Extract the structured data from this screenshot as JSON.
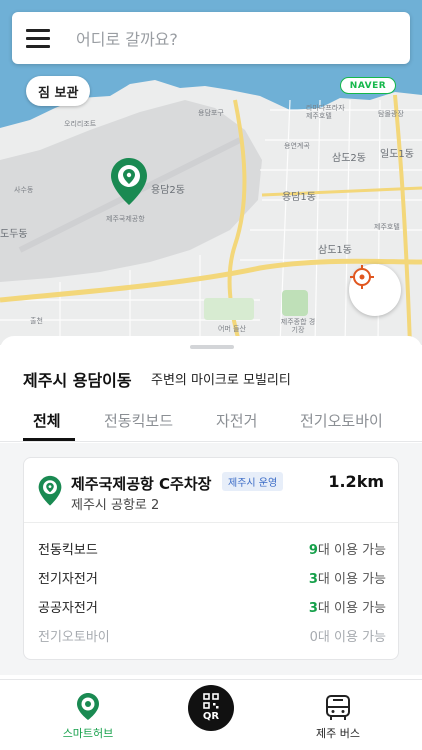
{
  "search": {
    "placeholder": "어디로 갈까요?"
  },
  "map": {
    "storage_chip": "짐 보관",
    "naver_logo": "NAVER",
    "labels": {
      "sadudong": "사두동",
      "okriresort": "오리리조트",
      "yongdam2": "용담2동",
      "yongdam1": "용담1동",
      "samdo2": "삼도2동",
      "ildo1": "일도1동",
      "samdo1": "삼도1동",
      "dodudong": "도두동",
      "jejuairport": "제주국제공항",
      "yongdamport": "용담포구",
      "ramadaplaza": "라마다프라자 제주호텔",
      "yongyeonbridge": "용연계곡",
      "tamnaplaza": "탐몰광장",
      "jejudonghotel": "제주호텔",
      "jejustadium": "제주종합 경기장",
      "eoseungsaeng": "어머 들산",
      "parcel": "출천",
      "sadu_small": "사수동"
    },
    "accent_pin": "#1a8a52"
  },
  "sheet": {
    "title": "제주시 용담이동",
    "subtitle": "주변의 마이크로 모빌리티",
    "tabs": [
      "전체",
      "전동킥보드",
      "자전거",
      "전기오토바이"
    ],
    "active_tab": 0
  },
  "hub": {
    "name": "제주국제공항 C주차장",
    "badge": "제주시 운영",
    "distance": "1.2km",
    "address": "제주시 공항로 2",
    "availability": [
      {
        "label": "전동킥보드",
        "count": "9",
        "suffix": "대 이용 가능",
        "dim": false
      },
      {
        "label": "전기자전거",
        "count": "3",
        "suffix": "대 이용 가능",
        "dim": false
      },
      {
        "label": "공공자전거",
        "count": "3",
        "suffix": "대 이용 가능",
        "dim": false
      },
      {
        "label": "전기오토바이",
        "count": "0",
        "suffix": "대 이용 가능",
        "dim": true
      }
    ]
  },
  "nav": {
    "hub_label": "스마트허브",
    "qr_label": "QR",
    "bus_label": "제주 버스"
  },
  "colors": {
    "green": "#15a04a",
    "pin": "#1a8a52",
    "badge_bg": "#e7eef9",
    "badge_text": "#3a6bc6"
  }
}
